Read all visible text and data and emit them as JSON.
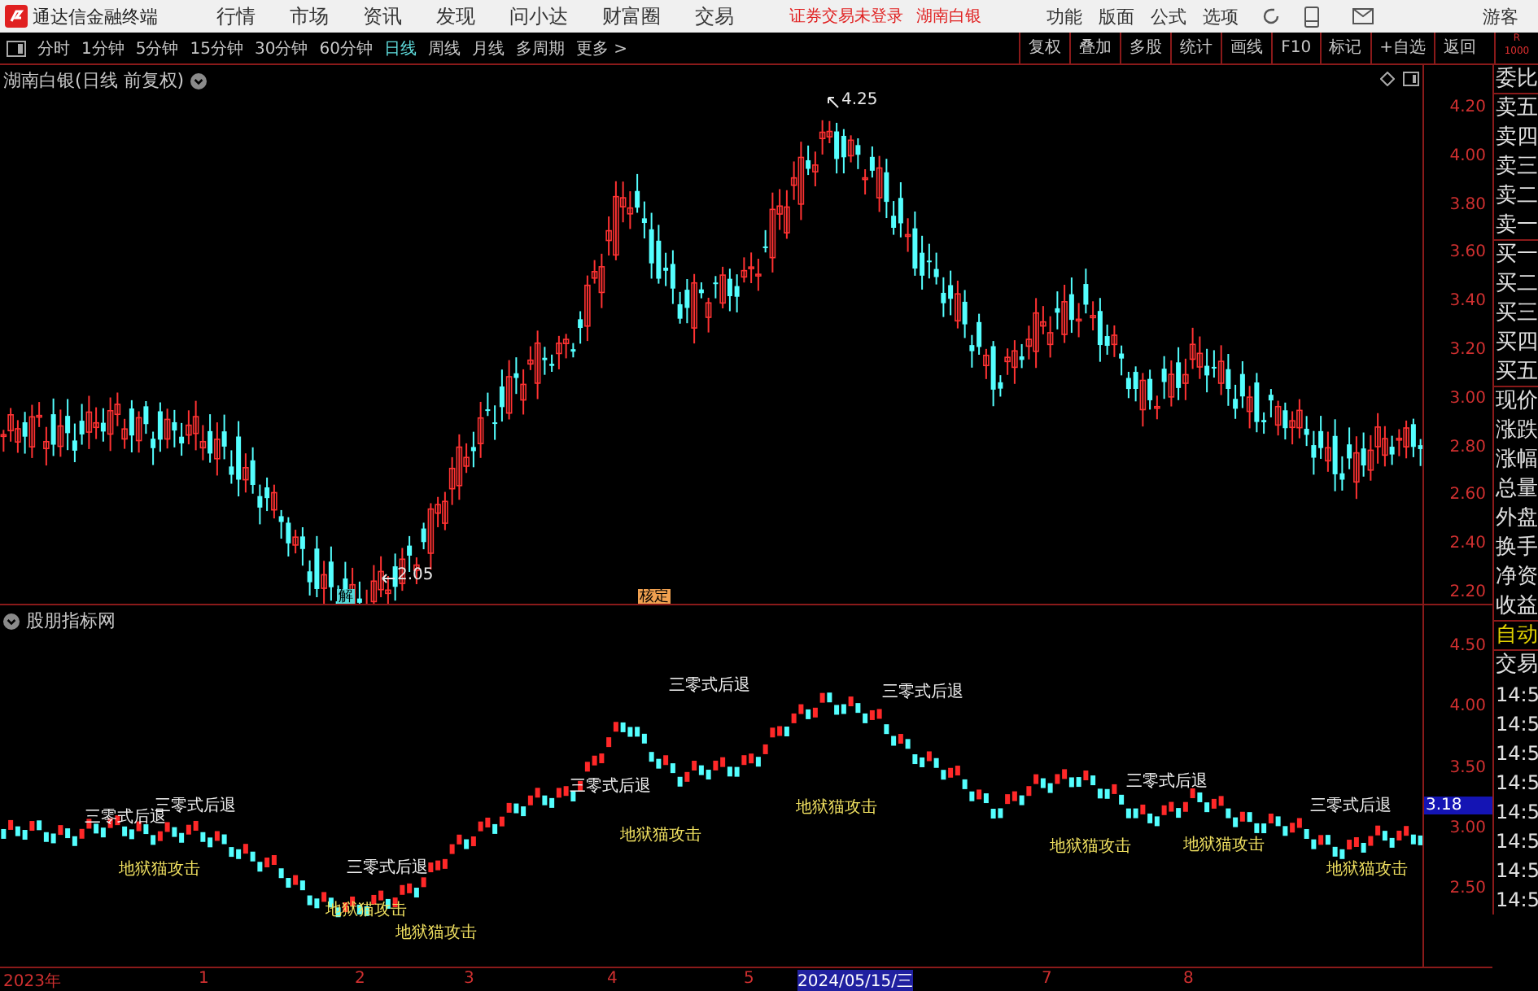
{
  "app": {
    "title": "通达信金融终端",
    "status": "证券交易未登录",
    "stock": "湖南白银",
    "guest": "游客"
  },
  "menu": [
    "行情",
    "市场",
    "资讯",
    "发现",
    "问小达",
    "财富圈",
    "交易"
  ],
  "menu_right": [
    "功能",
    "版面",
    "公式",
    "选项"
  ],
  "periods": [
    {
      "label": "分时",
      "selected": false
    },
    {
      "label": "1分钟",
      "selected": false
    },
    {
      "label": "5分钟",
      "selected": false
    },
    {
      "label": "15分钟",
      "selected": false
    },
    {
      "label": "30分钟",
      "selected": false
    },
    {
      "label": "60分钟",
      "selected": false
    },
    {
      "label": "日线",
      "selected": true
    },
    {
      "label": "周线",
      "selected": false
    },
    {
      "label": "月线",
      "selected": false
    },
    {
      "label": "多周期",
      "selected": false
    },
    {
      "label": "更多 >",
      "selected": false
    }
  ],
  "tools": [
    "复权",
    "叠加",
    "多股",
    "统计",
    "画线",
    "F10",
    "标记",
    "+自选",
    "返回"
  ],
  "corner": {
    "line_1": "R",
    "line_2": "1000"
  },
  "main_chart": {
    "title": "湖南白银(日线 前复权)",
    "high": "4.25",
    "low": "2.05",
    "markers": [
      {
        "text": "解",
        "kind": "cyan"
      },
      {
        "text": "核定",
        "kind": "orange"
      }
    ],
    "yticks": [
      "4.20",
      "4.00",
      "3.80",
      "3.60",
      "3.40",
      "3.20",
      "3.00",
      "2.80",
      "2.60",
      "2.40",
      "2.20"
    ]
  },
  "indicator": {
    "title": "股朋指标网",
    "current": "3.18",
    "yticks": [
      "4.50",
      "4.00",
      "3.50",
      "3.00",
      "2.50"
    ],
    "labels": [
      {
        "text": "三零式后退",
        "kind": "retreat"
      },
      {
        "text": "三零式后退",
        "kind": "retreat"
      },
      {
        "text": "三零式后退",
        "kind": "retreat"
      },
      {
        "text": "三零式后退",
        "kind": "retreat"
      },
      {
        "text": "三零式后退",
        "kind": "retreat"
      },
      {
        "text": "三零式后退",
        "kind": "retreat"
      },
      {
        "text": "三零式后退",
        "kind": "retreat"
      },
      {
        "text": "三零式后退",
        "kind": "retreat"
      },
      {
        "text": "地狱猫攻击",
        "kind": "attack"
      },
      {
        "text": "地狱猫攻击",
        "kind": "attack"
      },
      {
        "text": "地狱猫攻击",
        "kind": "attack"
      },
      {
        "text": "地狱猫攻击",
        "kind": "attack"
      },
      {
        "text": "地狱猫攻击",
        "kind": "attack"
      },
      {
        "text": "地狱猫攻击",
        "kind": "attack"
      },
      {
        "text": "地狱猫攻击",
        "kind": "attack"
      },
      {
        "text": "地狱猫攻击",
        "kind": "attack"
      }
    ]
  },
  "dates": [
    {
      "label": "2023年",
      "selected": false
    },
    {
      "label": "1",
      "selected": false
    },
    {
      "label": "2",
      "selected": false
    },
    {
      "label": "3",
      "selected": false
    },
    {
      "label": "4",
      "selected": false
    },
    {
      "label": "5",
      "selected": false
    },
    {
      "label": "2024/05/15/三",
      "selected": true
    },
    {
      "label": "7",
      "selected": false
    },
    {
      "label": "8",
      "selected": false
    }
  ],
  "quote_panel": [
    {
      "text": "委比",
      "kind": "group"
    },
    {
      "text": "卖五",
      "kind": "label"
    },
    {
      "text": "卖四",
      "kind": "label"
    },
    {
      "text": "卖三",
      "kind": "label"
    },
    {
      "text": "卖二",
      "kind": "label"
    },
    {
      "text": "卖一",
      "kind": "group"
    },
    {
      "text": "买一",
      "kind": "label"
    },
    {
      "text": "买二",
      "kind": "label"
    },
    {
      "text": "买三",
      "kind": "label"
    },
    {
      "text": "买四",
      "kind": "label"
    },
    {
      "text": "买五",
      "kind": "group"
    },
    {
      "text": "现价",
      "kind": "label"
    },
    {
      "text": "涨跌",
      "kind": "label"
    },
    {
      "text": "涨幅",
      "kind": "label"
    },
    {
      "text": "总量",
      "kind": "label"
    },
    {
      "text": "外盘",
      "kind": "label"
    },
    {
      "text": "换手",
      "kind": "label"
    },
    {
      "text": "净资",
      "kind": "label"
    },
    {
      "text": "收益",
      "kind": "group"
    },
    {
      "text": "自动",
      "kind": "auto"
    },
    {
      "text": "交易",
      "kind": "label"
    },
    {
      "text": "14:5",
      "kind": "time"
    },
    {
      "text": "14:5",
      "kind": "time"
    },
    {
      "text": "14:5",
      "kind": "time"
    },
    {
      "text": "14:5",
      "kind": "time"
    },
    {
      "text": "14:5",
      "kind": "time"
    },
    {
      "text": "14:5",
      "kind": "time"
    },
    {
      "text": "14:5",
      "kind": "time"
    },
    {
      "text": "14:5",
      "kind": "time"
    }
  ]
}
